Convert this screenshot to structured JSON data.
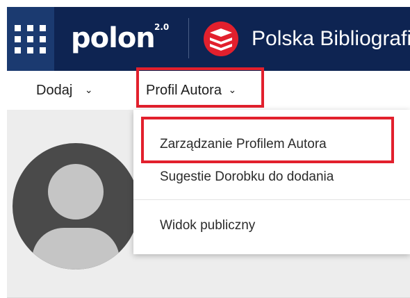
{
  "header": {
    "logo": "polon",
    "logo_version": "2.0",
    "brand_name": "Polska Bibliografia Naukowa"
  },
  "nav": {
    "items": [
      {
        "label": "Dodaj",
        "chevron": "⌄"
      },
      {
        "label": "Profil Autora",
        "chevron": "⌄"
      }
    ]
  },
  "dropdown": {
    "items": [
      {
        "label": "Zarządzanie Profilem Autora"
      },
      {
        "label": "Sugestie Dorobku do dodania"
      },
      {
        "label": "Widok publiczny"
      }
    ]
  },
  "colors": {
    "header_bg": "#0e2452",
    "apps_bg": "#1b3a70",
    "highlight": "#e2202d",
    "brand_icon": "#e2202d"
  },
  "icons": {
    "apps": "grid-dots-icon",
    "brand": "pbn-logo-icon",
    "avatar": "user-avatar-icon"
  }
}
